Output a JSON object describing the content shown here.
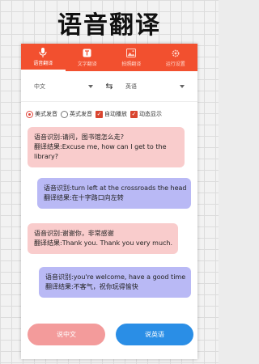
{
  "headline": "语音翻译",
  "tabs": [
    {
      "label": "语音翻译",
      "icon": "microphone-icon",
      "active": true
    },
    {
      "label": "文字翻译",
      "icon": "text-icon",
      "active": false
    },
    {
      "label": "拍照翻译",
      "icon": "image-icon",
      "active": false
    },
    {
      "label": "运行设置",
      "icon": "gear-icon",
      "active": false
    }
  ],
  "languages": {
    "source": "中文",
    "target": "英语",
    "swap_icon": "swap-icon"
  },
  "options": {
    "us_pron": "美式发音",
    "uk_pron": "英式发音",
    "autoplay": "自动播放",
    "dynamic": "动态显示"
  },
  "messages": [
    {
      "side": "left",
      "line1": "语音识别:请问，图书馆怎么走?",
      "line2": "翻译结果:Excuse me, how can I get to the",
      "line3": "library?"
    },
    {
      "side": "right",
      "line1": "语音识别:turn left at the crossroads the head",
      "line2": "翻译结果:在十字路口向左转"
    },
    {
      "side": "left",
      "line1": "语音识别:谢谢你，非常感谢",
      "line2": "翻译结果:Thank you. Thank you very much."
    },
    {
      "side": "right",
      "line1": "语音识别:you're welcome, have a good time",
      "line2": "翻译结果:不客气，祝你玩得愉快"
    }
  ],
  "buttons": {
    "speak_chinese": "说中文",
    "speak_english": "说英语"
  },
  "colors": {
    "accent": "#f2502f",
    "left_bubble": "#f9cccc",
    "right_bubble": "#b9b9f5",
    "english_button": "#2a8ee6",
    "chinese_button": "#f39b9b"
  }
}
